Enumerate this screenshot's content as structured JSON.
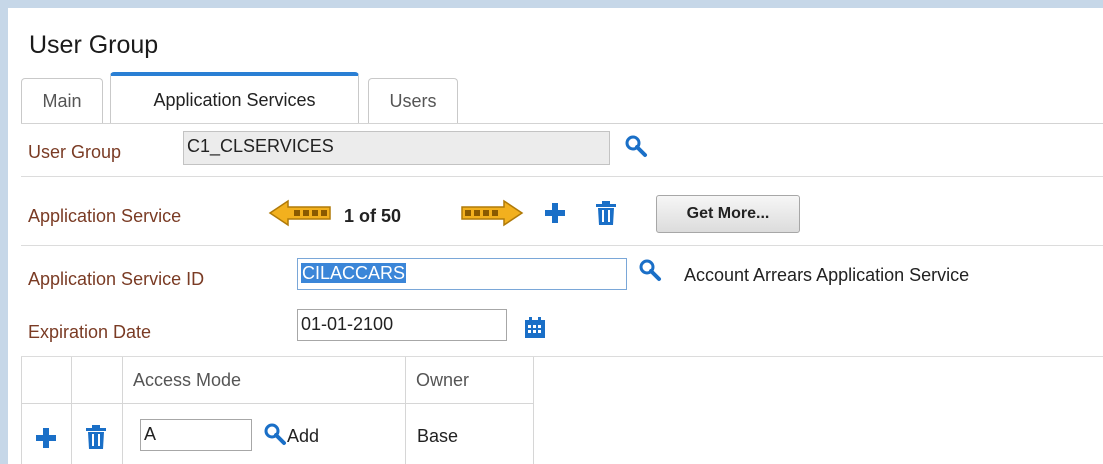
{
  "page": {
    "title": "User Group"
  },
  "tabs": [
    {
      "label": "Main"
    },
    {
      "label": "Application Services"
    },
    {
      "label": "Users"
    }
  ],
  "user_group": {
    "label": "User Group",
    "value": "C1_CLSERVICES"
  },
  "app_service_nav": {
    "label": "Application Service",
    "counter": "1 of 50",
    "get_more_label": "Get More..."
  },
  "app_service_id": {
    "label": "Application Service ID",
    "value": "CILACCARS",
    "description": "Account Arrears Application Service"
  },
  "expiration": {
    "label": "Expiration Date",
    "value": "01-01-2100"
  },
  "grid": {
    "headers": {
      "access_mode": "Access Mode",
      "owner": "Owner"
    },
    "rows": [
      {
        "access_mode": "A",
        "access_desc": "Add",
        "owner": "Base"
      }
    ]
  },
  "colors": {
    "accent": "#2a7fd4",
    "label": "#7a3b24",
    "icon_blue": "#1a6fc7",
    "arrow_gold": "#f2b01e"
  }
}
